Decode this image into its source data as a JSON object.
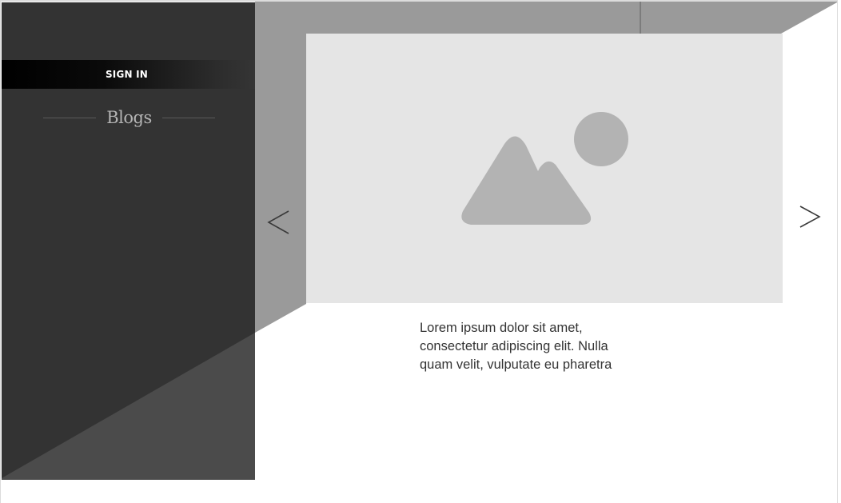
{
  "sidebar": {
    "signin_label": "SIGN IN",
    "blogs_label": "Blogs"
  },
  "carousel": {
    "prev_icon": "chevron-left-icon",
    "next_icon": "chevron-right-icon",
    "image_icon": "image-placeholder-icon",
    "caption_lines": [
      "Lorem ipsum dolor sit amet,",
      "consectetur adipiscing elit. Nulla",
      "quam velit, vulputate eu pharetra"
    ]
  },
  "colors": {
    "sidebar_bg": "#333333",
    "top_band": "#9a9a9a",
    "image_bg": "#e5e5e5",
    "placeholder_shape": "#b3b3b3"
  }
}
